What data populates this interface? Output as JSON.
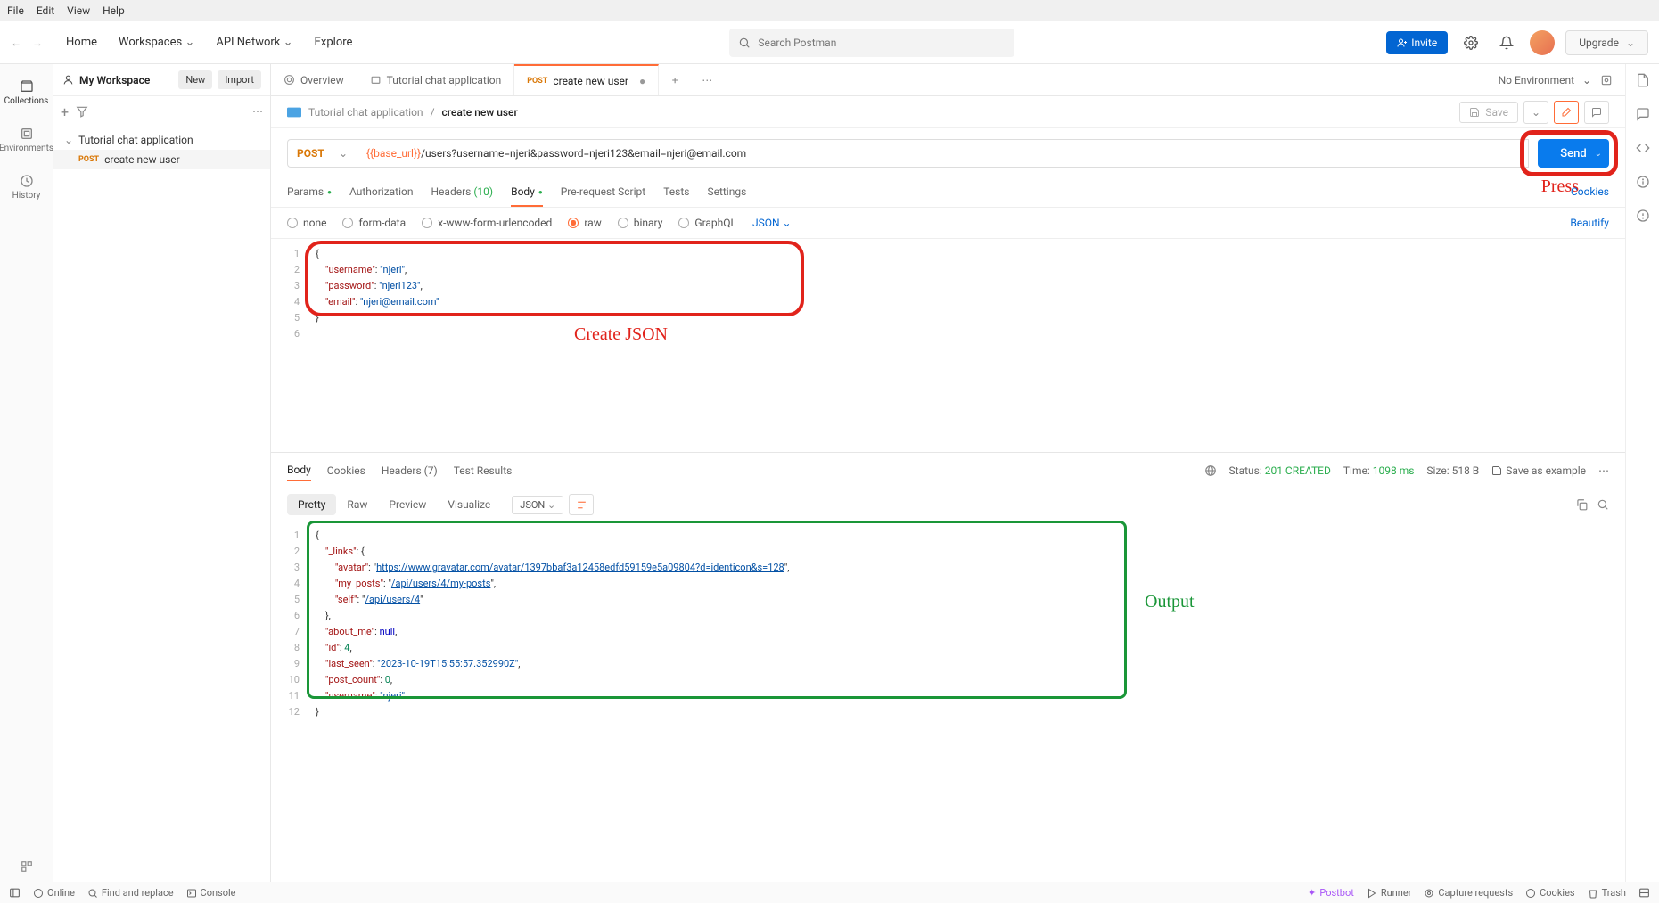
{
  "menubar": {
    "file": "File",
    "edit": "Edit",
    "view": "View",
    "help": "Help"
  },
  "topnav": {
    "home": "Home",
    "workspaces": "Workspaces",
    "api_network": "API Network",
    "explore": "Explore",
    "search_placeholder": "Search Postman",
    "invite": "Invite",
    "upgrade": "Upgrade"
  },
  "workspace": {
    "name": "My Workspace",
    "new": "New",
    "import": "Import",
    "collection": "Tutorial chat application",
    "request_method": "POST",
    "request_name": "create new user"
  },
  "sidebar": {
    "collections": "Collections",
    "environments": "Environments",
    "history": "History"
  },
  "tabs": {
    "overview": "Overview",
    "coll_tab": "Tutorial chat application",
    "req_method": "POST",
    "req_name": "create new user",
    "env": "No Environment"
  },
  "crumb": {
    "coll": "Tutorial chat application",
    "req": "create new user",
    "save": "Save"
  },
  "request": {
    "method": "POST",
    "url_var": "{{base_url}}",
    "url_rest": "/users?username=njeri&password=njeri123&email=njeri@email.com",
    "send": "Send"
  },
  "annotations": {
    "press": "Press",
    "create_json": "Create  JSON",
    "output": "Output"
  },
  "subtabs": {
    "params": "Params",
    "auth": "Authorization",
    "headers": "Headers",
    "headers_count": "(10)",
    "body": "Body",
    "prereq": "Pre-request Script",
    "tests": "Tests",
    "settings": "Settings",
    "cookies": "Cookies"
  },
  "body_types": {
    "none": "none",
    "formdata": "form-data",
    "urlencoded": "x-www-form-urlencoded",
    "raw": "raw",
    "binary": "binary",
    "graphql": "GraphQL",
    "json": "JSON",
    "beautify": "Beautify"
  },
  "req_body": {
    "lines": [
      "1",
      "2",
      "3",
      "4",
      "5",
      "6"
    ],
    "k_user": "\"username\"",
    "v_user": "\"njeri\"",
    "k_pass": "\"password\"",
    "v_pass": "\"njeri123\"",
    "k_email": "\"email\"",
    "v_email": "\"njeri@email.com\""
  },
  "response": {
    "tabs": {
      "body": "Body",
      "cookies": "Cookies",
      "headers": "Headers",
      "headers_count": "(7)",
      "tests": "Test Results"
    },
    "status_lbl": "Status:",
    "status_val": "201 CREATED",
    "time_lbl": "Time:",
    "time_val": "1098 ms",
    "size_lbl": "Size:",
    "size_val": "518 B",
    "save_example": "Save as example",
    "views": {
      "pretty": "Pretty",
      "raw": "Raw",
      "preview": "Preview",
      "visualize": "Visualize",
      "json": "JSON"
    }
  },
  "resp_body": {
    "lines": [
      "1",
      "2",
      "3",
      "4",
      "5",
      "6",
      "7",
      "8",
      "9",
      "10",
      "11",
      "12"
    ],
    "k_links": "\"_links\"",
    "k_avatar": "\"avatar\"",
    "v_avatar": "https://www.gravatar.com/avatar/1397bbaf3a12458edfd59159e5a09804?d=identicon&s=128",
    "k_myposts": "\"my_posts\"",
    "v_myposts": "/api/users/4/my-posts",
    "k_self": "\"self\"",
    "v_self": "/api/users/4",
    "k_about": "\"about_me\"",
    "v_about": "null",
    "k_id": "\"id\"",
    "v_id": "4",
    "k_lastseen": "\"last_seen\"",
    "v_lastseen": "\"2023-10-19T15:55:57.352990Z\"",
    "k_postcount": "\"post_count\"",
    "v_postcount": "0",
    "k_username": "\"username\"",
    "v_username": "\"njeri\""
  },
  "footer": {
    "online": "Online",
    "find": "Find and replace",
    "console": "Console",
    "postbot": "Postbot",
    "runner": "Runner",
    "capture": "Capture requests",
    "cookies": "Cookies",
    "trash": "Trash"
  }
}
